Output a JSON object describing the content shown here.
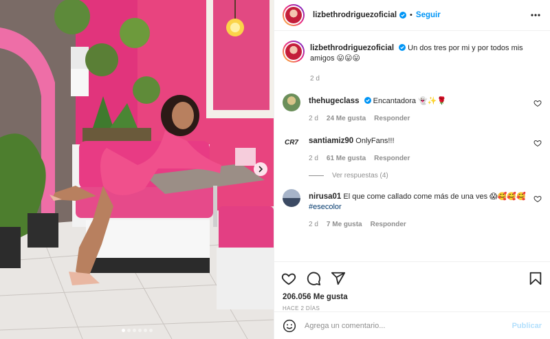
{
  "post": {
    "username": "lizbethrodriguezoficial",
    "follow_label": "Seguir",
    "separator": "•",
    "caption_text": "Un dos tres por mi y por todos mis amigos 😛😛😛",
    "caption_time": "2 d",
    "likes": "206.056 Me gusta",
    "date": "HACE 2 DÍAS",
    "images_total": 6,
    "current_image": 1
  },
  "comments": [
    {
      "username": "thehugeclass",
      "verified": true,
      "text": "Encantadora 👻✨🌹",
      "time": "2 d",
      "likes": "24 Me gusta",
      "reply": "Responder"
    },
    {
      "username": "santiamiz90",
      "verified": false,
      "text": "OnlyFans!!!",
      "time": "2 d",
      "likes": "61 Me gusta",
      "reply": "Responder",
      "view_replies": "Ver respuestas (4)"
    },
    {
      "username": "nirusa01",
      "verified": false,
      "text": "El que come callado come más de una ves 😱🥰🥰🥰",
      "hashtag": "#esecolor",
      "time": "2 d",
      "likes": "7 Me gusta",
      "reply": "Responder"
    }
  ],
  "add_comment": {
    "placeholder": "Agrega un comentario...",
    "publish_label": "Publicar"
  },
  "icons": {
    "more": "more-horizontal-icon",
    "like": "heart-icon",
    "comment": "comment-icon",
    "share": "share-icon",
    "save": "bookmark-icon",
    "emoji": "emoji-icon",
    "next": "chevron-right-icon",
    "verified": "verified-badge-icon"
  },
  "colors": {
    "accent": "#0095f6",
    "publish_disabled": "#b2dffc",
    "hashtag": "#00376b",
    "muted": "#8e8e8e",
    "verified": "#0095f6"
  }
}
